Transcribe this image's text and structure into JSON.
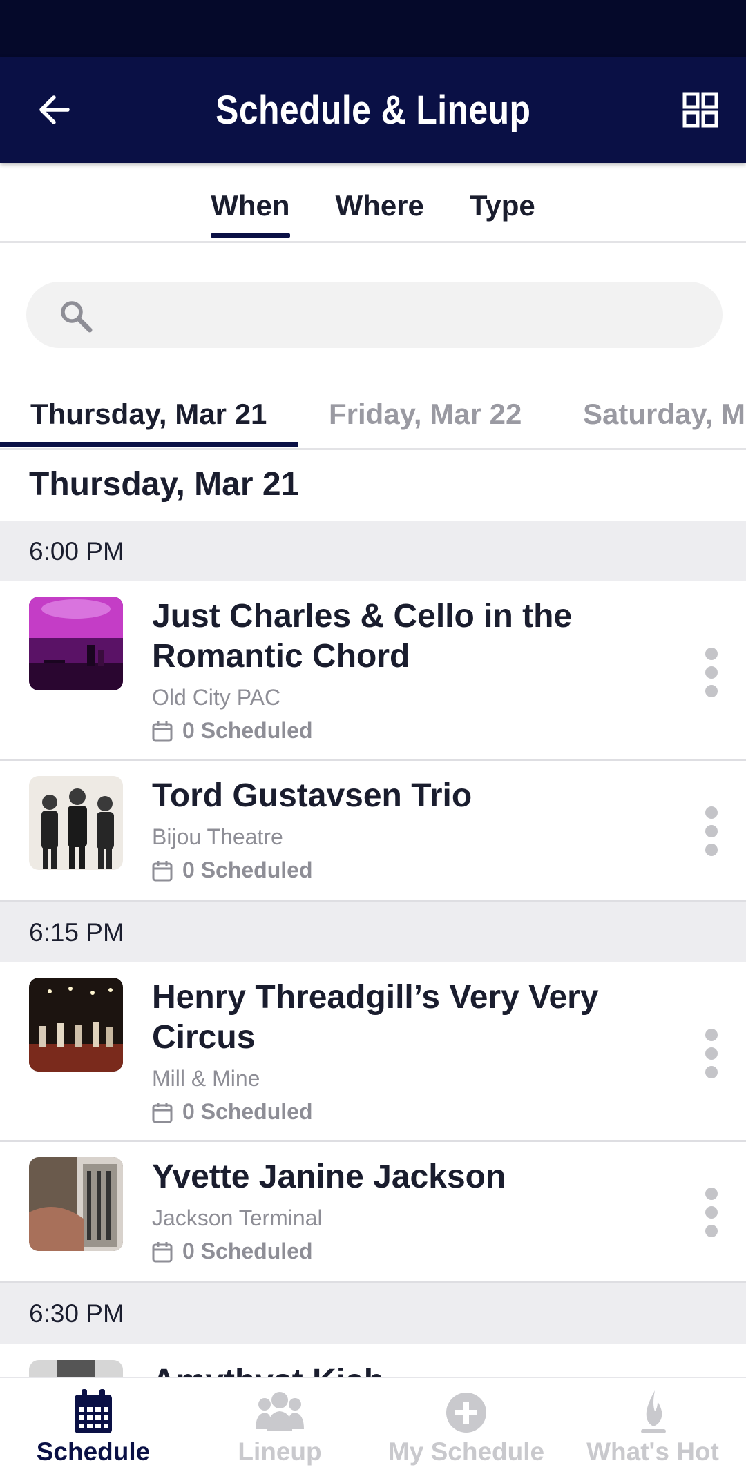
{
  "header": {
    "title": "Schedule & Lineup"
  },
  "filter_tabs": [
    {
      "label": "When",
      "active": true
    },
    {
      "label": "Where",
      "active": false
    },
    {
      "label": "Type",
      "active": false
    }
  ],
  "search": {
    "placeholder": ""
  },
  "day_tabs": [
    {
      "label": "Thursday, Mar 21",
      "active": true
    },
    {
      "label": "Friday, Mar 22",
      "active": false
    },
    {
      "label": "Saturday, Ma",
      "active": false
    }
  ],
  "day_heading": "Thursday, Mar 21",
  "time_slots": [
    {
      "time": "6:00 PM",
      "events": [
        {
          "title": "Just Charles & Cello in the Romantic Chord",
          "venue": "Old City PAC",
          "scheduled": "0 Scheduled"
        },
        {
          "title": "Tord Gustavsen Trio",
          "venue": "Bijou Theatre",
          "scheduled": "0 Scheduled"
        }
      ]
    },
    {
      "time": "6:15 PM",
      "events": [
        {
          "title": "Henry Threadgill’s Very Very Circus",
          "venue": "Mill & Mine",
          "scheduled": "0 Scheduled"
        },
        {
          "title": "Yvette Janine Jackson",
          "venue": "Jackson Terminal",
          "scheduled": "0 Scheduled"
        }
      ]
    },
    {
      "time": "6:30 PM",
      "events": [
        {
          "title": "Amythyst Kiah",
          "venue": "",
          "scheduled": ""
        }
      ]
    }
  ],
  "bottom_nav": [
    {
      "label": "Schedule",
      "icon": "calendar-icon",
      "active": true
    },
    {
      "label": "Lineup",
      "icon": "people-icon",
      "active": false
    },
    {
      "label": "My Schedule",
      "icon": "plus-circle-icon",
      "active": false
    },
    {
      "label": "What's Hot",
      "icon": "flame-icon",
      "active": false
    }
  ],
  "colors": {
    "header_bg": "#0a1045",
    "status_bg": "#05092a",
    "accent": "#0a1045",
    "muted_text": "#8e8e96",
    "band_bg": "#ededf0"
  }
}
